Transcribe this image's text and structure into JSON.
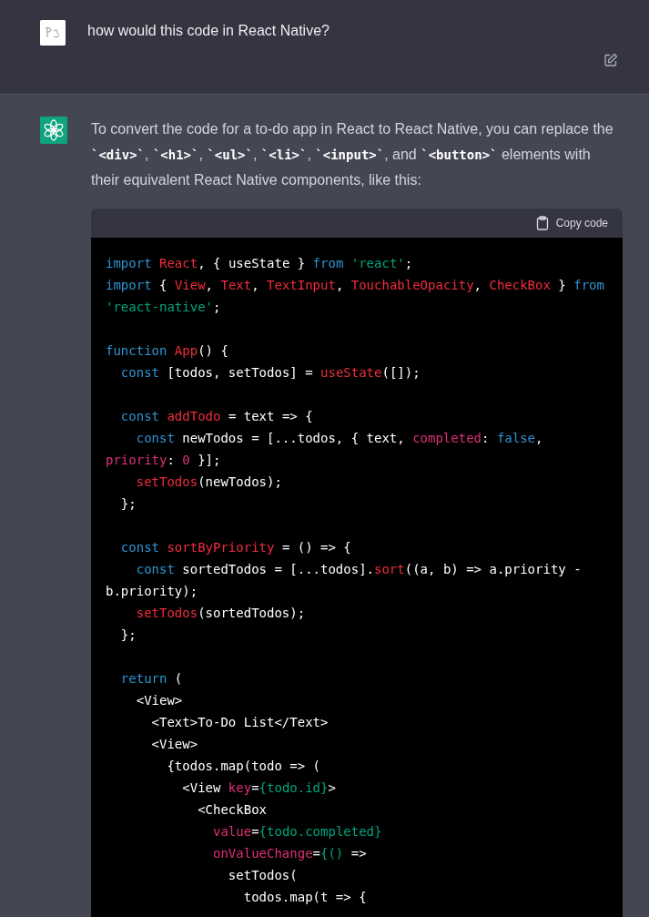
{
  "user_message": {
    "text": "how would this code in React Native?"
  },
  "assistant_message": {
    "paragraph": [
      {
        "kind": "text",
        "text": "To convert the code for a to-do app in React to React Native, you can replace the "
      },
      {
        "kind": "code",
        "text": "`<div>`"
      },
      {
        "kind": "text",
        "text": ", "
      },
      {
        "kind": "code",
        "text": "`<h1>`"
      },
      {
        "kind": "text",
        "text": ", "
      },
      {
        "kind": "code",
        "text": "`<ul>`"
      },
      {
        "kind": "text",
        "text": ", "
      },
      {
        "kind": "code",
        "text": "`<li>`"
      },
      {
        "kind": "text",
        "text": ", "
      },
      {
        "kind": "code",
        "text": "`<input>`"
      },
      {
        "kind": "text",
        "text": ", and "
      },
      {
        "kind": "code",
        "text": "`<button>`"
      },
      {
        "kind": "text",
        "text": " elements with their equivalent React Native components, like this:"
      }
    ],
    "code_block": {
      "copy_label": "Copy code",
      "blocks": [
        [
          [
            {
              "kind": "keyword",
              "text": "import "
            },
            {
              "kind": "name",
              "text": "React"
            },
            {
              "kind": "plain",
              "text": ", { useState } "
            },
            {
              "kind": "keyword",
              "text": "from "
            },
            {
              "kind": "string",
              "text": "'react'"
            },
            {
              "kind": "plain",
              "text": ";"
            }
          ],
          [
            {
              "kind": "keyword",
              "text": "import"
            },
            {
              "kind": "plain",
              "text": " { "
            },
            {
              "kind": "name",
              "text": "View"
            },
            {
              "kind": "plain",
              "text": ", "
            },
            {
              "kind": "name",
              "text": "Text"
            },
            {
              "kind": "plain",
              "text": ", "
            },
            {
              "kind": "name",
              "text": "TextInput"
            },
            {
              "kind": "plain",
              "text": ", "
            },
            {
              "kind": "name",
              "text": "TouchableOpacity"
            },
            {
              "kind": "plain",
              "text": ", "
            },
            {
              "kind": "name",
              "text": "CheckBox"
            },
            {
              "kind": "plain",
              "text": " } "
            },
            {
              "kind": "keyword",
              "text": "from"
            }
          ],
          [
            {
              "kind": "string",
              "text": "'react-native'"
            },
            {
              "kind": "plain",
              "text": ";"
            }
          ]
        ],
        [
          [
            {
              "kind": "keyword",
              "text": "function "
            },
            {
              "kind": "name",
              "text": "App"
            },
            {
              "kind": "plain",
              "text": "() {"
            }
          ],
          [
            {
              "kind": "keyword",
              "text": "  const"
            },
            {
              "kind": "plain",
              "text": " [todos, setTodos] = "
            },
            {
              "kind": "name",
              "text": "useState"
            },
            {
              "kind": "plain",
              "text": "([]);"
            }
          ]
        ],
        [
          [
            {
              "kind": "keyword",
              "text": "  const "
            },
            {
              "kind": "name",
              "text": "addTodo"
            },
            {
              "kind": "plain",
              "text": " = text => {"
            }
          ],
          [
            {
              "kind": "keyword",
              "text": "    const"
            },
            {
              "kind": "plain",
              "text": " newTodos = [...todos, { text, "
            },
            {
              "kind": "attr",
              "text": "completed"
            },
            {
              "kind": "plain",
              "text": ": "
            },
            {
              "kind": "keyword",
              "text": "false"
            },
            {
              "kind": "plain",
              "text": ","
            }
          ],
          [
            {
              "kind": "attr",
              "text": "priority"
            },
            {
              "kind": "plain",
              "text": ": "
            },
            {
              "kind": "attr",
              "text": "0"
            },
            {
              "kind": "plain",
              "text": " }];"
            }
          ],
          [
            {
              "kind": "name",
              "text": "    setTodos"
            },
            {
              "kind": "plain",
              "text": "(newTodos);"
            }
          ],
          [
            {
              "kind": "plain",
              "text": "  };"
            }
          ]
        ],
        [
          [
            {
              "kind": "keyword",
              "text": "  const "
            },
            {
              "kind": "name",
              "text": "sortByPriority"
            },
            {
              "kind": "plain",
              "text": " = () => {"
            }
          ],
          [
            {
              "kind": "keyword",
              "text": "    const"
            },
            {
              "kind": "plain",
              "text": " sortedTodos = [...todos]."
            },
            {
              "kind": "name",
              "text": "sort"
            },
            {
              "kind": "plain",
              "text": "((a, b) => a.priority -"
            }
          ],
          [
            {
              "kind": "plain",
              "text": "b.priority);"
            }
          ],
          [
            {
              "kind": "name",
              "text": "    setTodos"
            },
            {
              "kind": "plain",
              "text": "(sortedTodos);"
            }
          ],
          [
            {
              "kind": "plain",
              "text": "  };"
            }
          ]
        ],
        [
          [
            {
              "kind": "keyword",
              "text": "  return"
            },
            {
              "kind": "plain",
              "text": " ("
            }
          ],
          [
            {
              "kind": "plain",
              "text": "    <View>"
            }
          ],
          [
            {
              "kind": "plain",
              "text": "      <Text>To-Do List</Text>"
            }
          ],
          [
            {
              "kind": "plain",
              "text": "      <View>"
            }
          ],
          [
            {
              "kind": "plain",
              "text": "        {todos.map(todo => ("
            }
          ],
          [
            {
              "kind": "plain",
              "text": "          <View "
            },
            {
              "kind": "attr",
              "text": "key"
            },
            {
              "kind": "plain",
              "text": "="
            },
            {
              "kind": "string",
              "text": "{todo.id}"
            },
            {
              "kind": "plain",
              "text": ">"
            }
          ],
          [
            {
              "kind": "plain",
              "text": "            <CheckBox"
            }
          ],
          [
            {
              "kind": "attr",
              "text": "              value"
            },
            {
              "kind": "plain",
              "text": "="
            },
            {
              "kind": "string",
              "text": "{todo.completed}"
            }
          ],
          [
            {
              "kind": "attr",
              "text": "              onValueChange"
            },
            {
              "kind": "plain",
              "text": "="
            },
            {
              "kind": "string",
              "text": "{()"
            },
            {
              "kind": "plain",
              "text": " =>"
            }
          ],
          [
            {
              "kind": "plain",
              "text": "                setTodos("
            }
          ],
          [
            {
              "kind": "plain",
              "text": "                  todos.map(t => {"
            }
          ]
        ]
      ]
    }
  }
}
